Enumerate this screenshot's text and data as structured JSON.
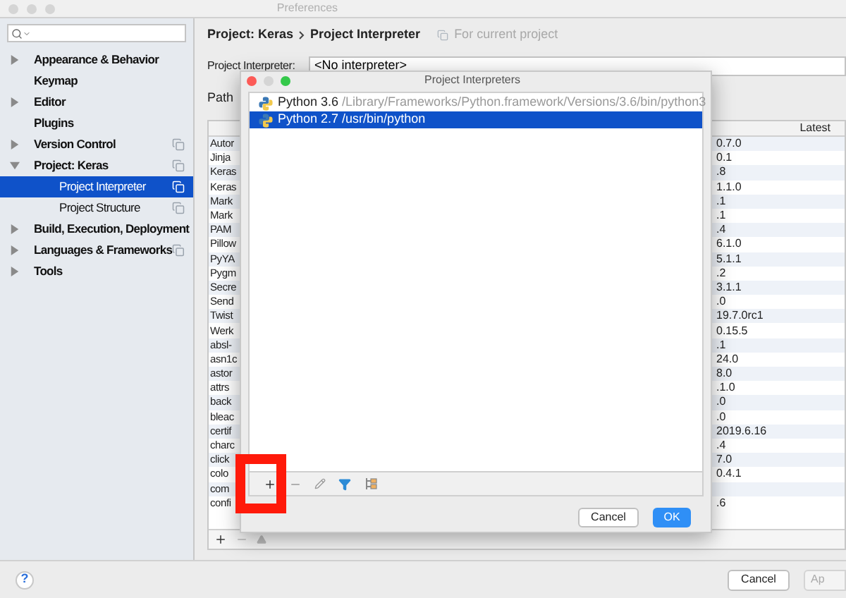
{
  "window": {
    "title": "Preferences"
  },
  "sidebar": {
    "items": [
      {
        "label": "Appearance & Behavior",
        "kind": "group",
        "expanded": false,
        "selected": false,
        "project_scoped": false
      },
      {
        "label": "Keymap",
        "kind": "page",
        "selected": false,
        "project_scoped": false
      },
      {
        "label": "Editor",
        "kind": "group",
        "expanded": false,
        "selected": false,
        "project_scoped": false
      },
      {
        "label": "Plugins",
        "kind": "page",
        "selected": false,
        "project_scoped": false
      },
      {
        "label": "Version Control",
        "kind": "group",
        "expanded": false,
        "selected": false,
        "project_scoped": true
      },
      {
        "label": "Project: Keras",
        "kind": "group",
        "expanded": true,
        "selected": false,
        "project_scoped": true,
        "children": [
          {
            "label": "Project Interpreter",
            "kind": "page",
            "selected": true,
            "project_scoped": true
          },
          {
            "label": "Project Structure",
            "kind": "page",
            "selected": false,
            "project_scoped": true
          }
        ]
      },
      {
        "label": "Build, Execution, Deployment",
        "kind": "group",
        "expanded": false,
        "selected": false,
        "project_scoped": false
      },
      {
        "label": "Languages & Frameworks",
        "kind": "group",
        "expanded": false,
        "selected": false,
        "project_scoped": true
      },
      {
        "label": "Tools",
        "kind": "group",
        "expanded": false,
        "selected": false,
        "project_scoped": false
      }
    ]
  },
  "breadcrumb": {
    "parent": "Project: Keras",
    "current": "Project Interpreter",
    "scope_note": "For current project"
  },
  "interpreter_field": {
    "label": "Project Interpreter:",
    "value": "<No interpreter>"
  },
  "path_label": "Path",
  "table": {
    "latest_label": "Latest",
    "rows": [
      {
        "column_1": "Autor",
        "column_2": "0.7.0"
      },
      {
        "column_1": "Jinja",
        "column_2": "0.1"
      },
      {
        "column_1": "Keras",
        "column_2": ".8"
      },
      {
        "column_1": "Keras",
        "column_2": "1.1.0"
      },
      {
        "column_1": "Mark",
        "column_2": ".1"
      },
      {
        "column_1": "Mark",
        "column_2": ".1"
      },
      {
        "column_1": "PAM",
        "column_2": ".4"
      },
      {
        "column_1": "Pillow",
        "column_2": "6.1.0"
      },
      {
        "column_1": "PyYA",
        "column_2": "5.1.1"
      },
      {
        "column_1": "Pygm",
        "column_2": ".2"
      },
      {
        "column_1": "Secre",
        "column_2": "3.1.1"
      },
      {
        "column_1": "Send",
        "column_2": ".0"
      },
      {
        "column_1": "Twist",
        "column_2": "19.7.0rc1"
      },
      {
        "column_1": "Werk",
        "column_2": "0.15.5"
      },
      {
        "column_1": "absl-",
        "column_2": ".1"
      },
      {
        "column_1": "asn1c",
        "column_2": "24.0"
      },
      {
        "column_1": "astor",
        "column_2": "8.0"
      },
      {
        "column_1": "attrs",
        "column_2": ".1.0"
      },
      {
        "column_1": "back",
        "column_2": ".0"
      },
      {
        "column_1": "bleac",
        "column_2": ".0"
      },
      {
        "column_1": "certif",
        "column_2": "2019.6.16"
      },
      {
        "column_1": "charc",
        "column_2": ".4"
      },
      {
        "column_1": "click",
        "column_2": "7.0"
      },
      {
        "column_1": "colo",
        "column_2": "0.4.1"
      },
      {
        "column_1": "com"
      },
      {
        "column_1": "confi",
        "column_2": ".6"
      }
    ]
  },
  "dialog": {
    "title": "Project Interpreters",
    "interpreters": [
      {
        "name": "Python 3.6",
        "path": "/Library/Frameworks/Python.framework/Versions/3.6/bin/python3",
        "selected": false
      },
      {
        "name": "Python 2.7",
        "path": "/usr/bin/python",
        "selected": true
      }
    ],
    "buttons": [
      {
        "label": "Cancel",
        "kind": "secondary"
      },
      {
        "label": "OK",
        "kind": "primary"
      }
    ]
  },
  "footer": {
    "help": "?",
    "buttons": [
      "Cancel",
      "Ap"
    ]
  }
}
